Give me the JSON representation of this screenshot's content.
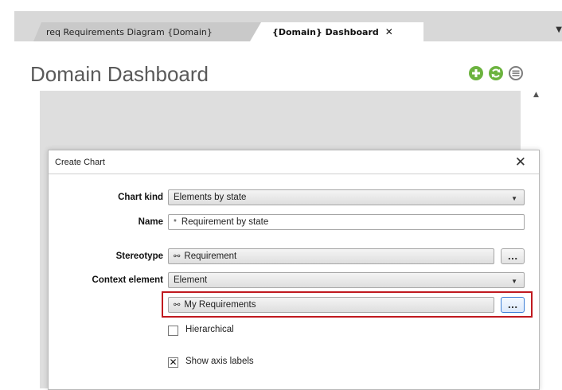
{
  "tabs": {
    "inactive_label": "req Requirements Diagram {Domain}",
    "active_label": "{Domain} Dashboard",
    "close_glyph": "✕",
    "overflow_glyph": "▼"
  },
  "dashboard": {
    "title": "Domain Dashboard",
    "icons": [
      "add-circle-icon",
      "refresh-circle-icon",
      "menu-circle-icon"
    ],
    "accent_color": "#6cb33f",
    "scroll_up_glyph": "▲"
  },
  "dialog": {
    "title": "Create Chart",
    "close_glyph": "✕",
    "fields": {
      "chart_kind": {
        "label": "Chart kind",
        "value": "Elements by state"
      },
      "name": {
        "label": "Name",
        "value": "Requirement by state",
        "required_marker": "*"
      },
      "stereotype": {
        "label": "Stereotype",
        "value": "Requirement",
        "browse": "..."
      },
      "context_element": {
        "label": "Context element",
        "value": "Element"
      },
      "context_value": {
        "value": "My Requirements",
        "browse": "..."
      }
    },
    "options": {
      "hierarchical": {
        "label": "Hierarchical",
        "checked": false
      },
      "show_axis_labels": {
        "label": "Show axis labels",
        "checked": true,
        "mark": "✕"
      }
    },
    "highlight_color": "#c0191f"
  }
}
